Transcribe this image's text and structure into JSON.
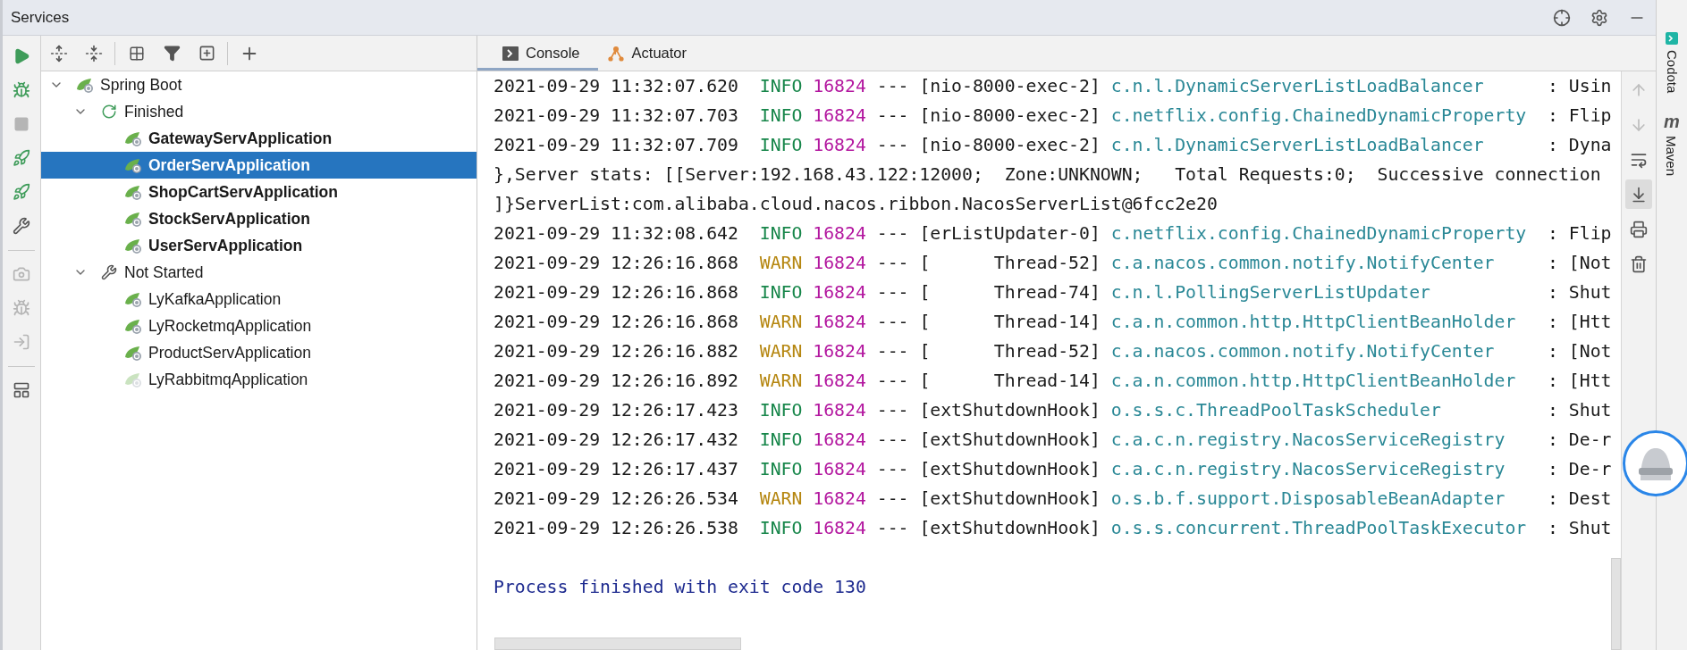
{
  "window": {
    "title": "Services"
  },
  "title_actions": [
    {
      "kind": "crosshair"
    },
    {
      "kind": "settings"
    },
    {
      "kind": "minimize"
    }
  ],
  "left_toolbar": {
    "groups": [
      {
        "buttons": [
          {
            "kind": "run",
            "disabled": false
          },
          {
            "kind": "debug",
            "disabled": false
          },
          {
            "kind": "stop",
            "disabled": true
          },
          {
            "kind": "rocket_run",
            "disabled": false
          },
          {
            "kind": "rocket_debug",
            "disabled": false
          },
          {
            "kind": "wrench",
            "disabled": false
          }
        ]
      },
      {
        "buttons": [
          {
            "kind": "camera",
            "disabled": true
          },
          {
            "kind": "attach_debugger",
            "disabled": true
          },
          {
            "kind": "login",
            "disabled": true
          }
        ]
      },
      {
        "buttons": [
          {
            "kind": "layout",
            "disabled": false
          }
        ]
      }
    ]
  },
  "tree_toolbar": {
    "groups": [
      {
        "buttons": [
          {
            "kind": "expand_all"
          },
          {
            "kind": "collapse_all"
          }
        ]
      },
      {
        "buttons": [
          {
            "kind": "group_by"
          },
          {
            "kind": "filter"
          },
          {
            "kind": "new_tab"
          }
        ]
      },
      {
        "buttons": [
          {
            "kind": "add"
          }
        ]
      }
    ]
  },
  "tree": [
    {
      "label": "Spring Boot",
      "kind": "springboot",
      "expanded": true,
      "children": [
        {
          "label": "Finished",
          "kind": "finished",
          "expanded": true,
          "children": [
            {
              "label": "GatewayServApplication",
              "kind": "app",
              "emphasized": true,
              "selected": false,
              "icon_dimmed": false
            },
            {
              "label": "OrderServApplication",
              "kind": "app",
              "emphasized": true,
              "selected": true,
              "icon_dimmed": false
            },
            {
              "label": "ShopCartServApplication",
              "kind": "app",
              "emphasized": true,
              "selected": false,
              "icon_dimmed": false
            },
            {
              "label": "StockServApplication",
              "kind": "app",
              "emphasized": true,
              "selected": false,
              "icon_dimmed": false
            },
            {
              "label": "UserServApplication",
              "kind": "app",
              "emphasized": true,
              "selected": false,
              "icon_dimmed": false
            }
          ]
        },
        {
          "label": "Not Started",
          "kind": "not_started",
          "expanded": true,
          "children": [
            {
              "label": "LyKafkaApplication",
              "kind": "app",
              "emphasized": false,
              "selected": false,
              "icon_dimmed": false
            },
            {
              "label": "LyRocketmqApplication",
              "kind": "app",
              "emphasized": false,
              "selected": false,
              "icon_dimmed": false
            },
            {
              "label": "ProductServApplication",
              "kind": "app",
              "emphasized": false,
              "selected": false,
              "icon_dimmed": false
            },
            {
              "label": "LyRabbitmqApplication",
              "kind": "app",
              "emphasized": false,
              "selected": false,
              "icon_dimmed": true
            }
          ]
        }
      ]
    }
  ],
  "console": {
    "tabs": [
      {
        "label": "Console",
        "kind": "console",
        "selected": true
      },
      {
        "label": "Actuator",
        "kind": "actuator",
        "selected": false
      }
    ],
    "lines": [
      {
        "kind": "info",
        "time": "2021-09-29 11:32:07.620",
        "level": "INFO",
        "pid": "16824",
        "sep": "---",
        "thread": "[nio-8000-exec-2]",
        "logger": "c.n.l.DynamicServerListLoadBalancer",
        "message": ": Usin"
      },
      {
        "kind": "info",
        "time": "2021-09-29 11:32:07.703",
        "level": "INFO",
        "pid": "16824",
        "sep": "---",
        "thread": "[nio-8000-exec-2]",
        "logger": "c.netflix.config.ChainedDynamicProperty",
        "message": ": Flip"
      },
      {
        "kind": "info",
        "time": "2021-09-29 11:32:07.709",
        "level": "INFO",
        "pid": "16824",
        "sep": "---",
        "thread": "[nio-8000-exec-2]",
        "logger": "c.n.l.DynamicServerListLoadBalancer",
        "message": ": Dyna"
      },
      {
        "kind": "text",
        "text": "},Server stats: [[Server:192.168.43.122:12000;  Zone:UNKNOWN;   Total Requests:0;  Successive connection"
      },
      {
        "kind": "text",
        "text": "]}ServerList:com.alibaba.cloud.nacos.ribbon.NacosServerList@6fcc2e20"
      },
      {
        "kind": "info",
        "time": "2021-09-29 11:32:08.642",
        "level": "INFO",
        "pid": "16824",
        "sep": "---",
        "thread": "[erListUpdater-0]",
        "logger": "c.netflix.config.ChainedDynamicProperty",
        "message": ": Flip"
      },
      {
        "kind": "warn",
        "time": "2021-09-29 12:26:16.868",
        "level": "WARN",
        "pid": "16824",
        "sep": "---",
        "thread": "[      Thread-52]",
        "logger": "c.a.nacos.common.notify.NotifyCenter",
        "message": ": [Not"
      },
      {
        "kind": "info",
        "time": "2021-09-29 12:26:16.868",
        "level": "INFO",
        "pid": "16824",
        "sep": "---",
        "thread": "[      Thread-74]",
        "logger": "c.n.l.PollingServerListUpdater",
        "message": ": Shut"
      },
      {
        "kind": "warn",
        "time": "2021-09-29 12:26:16.868",
        "level": "WARN",
        "pid": "16824",
        "sep": "---",
        "thread": "[      Thread-14]",
        "logger": "c.a.n.common.http.HttpClientBeanHolder",
        "message": ": [Htt"
      },
      {
        "kind": "warn",
        "time": "2021-09-29 12:26:16.882",
        "level": "WARN",
        "pid": "16824",
        "sep": "---",
        "thread": "[      Thread-52]",
        "logger": "c.a.nacos.common.notify.NotifyCenter",
        "message": ": [Not"
      },
      {
        "kind": "warn",
        "time": "2021-09-29 12:26:16.892",
        "level": "WARN",
        "pid": "16824",
        "sep": "---",
        "thread": "[      Thread-14]",
        "logger": "c.a.n.common.http.HttpClientBeanHolder",
        "message": ": [Htt"
      },
      {
        "kind": "info",
        "time": "2021-09-29 12:26:17.423",
        "level": "INFO",
        "pid": "16824",
        "sep": "---",
        "thread": "[extShutdownHook]",
        "logger": "o.s.s.c.ThreadPoolTaskScheduler",
        "message": ": Shut"
      },
      {
        "kind": "info",
        "time": "2021-09-29 12:26:17.432",
        "level": "INFO",
        "pid": "16824",
        "sep": "---",
        "thread": "[extShutdownHook]",
        "logger": "c.a.c.n.registry.NacosServiceRegistry",
        "message": ": De-r"
      },
      {
        "kind": "info",
        "time": "2021-09-29 12:26:17.437",
        "level": "INFO",
        "pid": "16824",
        "sep": "---",
        "thread": "[extShutdownHook]",
        "logger": "c.a.c.n.registry.NacosServiceRegistry",
        "message": ": De-r"
      },
      {
        "kind": "warn",
        "time": "2021-09-29 12:26:26.534",
        "level": "WARN",
        "pid": "16824",
        "sep": "---",
        "thread": "[extShutdownHook]",
        "logger": "o.s.b.f.support.DisposableBeanAdapter",
        "message": ": Dest"
      },
      {
        "kind": "info",
        "time": "2021-09-29 12:26:26.538",
        "level": "INFO",
        "pid": "16824",
        "sep": "---",
        "thread": "[extShutdownHook]",
        "logger": "o.s.s.concurrent.ThreadPoolTaskExecutor",
        "message": ": Shut"
      },
      {
        "kind": "exit",
        "text": "Process finished with exit code 130"
      }
    ],
    "toolbar": [
      {
        "kind": "up",
        "disabled": true,
        "selected": false
      },
      {
        "kind": "down",
        "disabled": true,
        "selected": false
      },
      {
        "kind": "soft_wrap",
        "disabled": false,
        "selected": false
      },
      {
        "kind": "scroll_to_end",
        "disabled": false,
        "selected": true
      },
      {
        "kind": "print",
        "disabled": false,
        "selected": false
      },
      {
        "kind": "clear",
        "disabled": false,
        "selected": false
      }
    ]
  },
  "side_strip": [
    {
      "kind": "codota",
      "label": "Codota"
    },
    {
      "kind": "maven",
      "label": "Maven",
      "icon_text": "m"
    }
  ]
}
